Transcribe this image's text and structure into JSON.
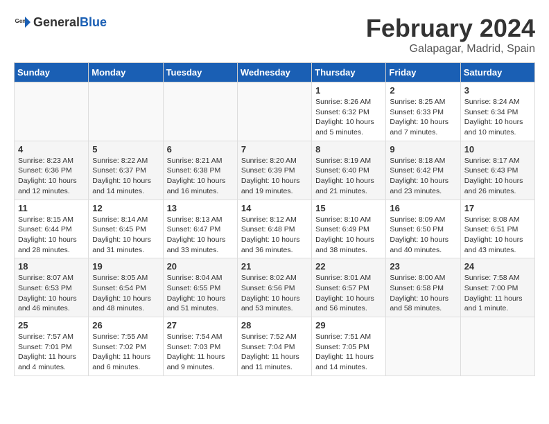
{
  "header": {
    "logo_general": "General",
    "logo_blue": "Blue",
    "main_title": "February 2024",
    "subtitle": "Galapagar, Madrid, Spain"
  },
  "calendar": {
    "columns": [
      "Sunday",
      "Monday",
      "Tuesday",
      "Wednesday",
      "Thursday",
      "Friday",
      "Saturday"
    ],
    "rows": [
      [
        {
          "day": "",
          "info": ""
        },
        {
          "day": "",
          "info": ""
        },
        {
          "day": "",
          "info": ""
        },
        {
          "day": "",
          "info": ""
        },
        {
          "day": "1",
          "info": "Sunrise: 8:26 AM\nSunset: 6:32 PM\nDaylight: 10 hours\nand 5 minutes."
        },
        {
          "day": "2",
          "info": "Sunrise: 8:25 AM\nSunset: 6:33 PM\nDaylight: 10 hours\nand 7 minutes."
        },
        {
          "day": "3",
          "info": "Sunrise: 8:24 AM\nSunset: 6:34 PM\nDaylight: 10 hours\nand 10 minutes."
        }
      ],
      [
        {
          "day": "4",
          "info": "Sunrise: 8:23 AM\nSunset: 6:36 PM\nDaylight: 10 hours\nand 12 minutes."
        },
        {
          "day": "5",
          "info": "Sunrise: 8:22 AM\nSunset: 6:37 PM\nDaylight: 10 hours\nand 14 minutes."
        },
        {
          "day": "6",
          "info": "Sunrise: 8:21 AM\nSunset: 6:38 PM\nDaylight: 10 hours\nand 16 minutes."
        },
        {
          "day": "7",
          "info": "Sunrise: 8:20 AM\nSunset: 6:39 PM\nDaylight: 10 hours\nand 19 minutes."
        },
        {
          "day": "8",
          "info": "Sunrise: 8:19 AM\nSunset: 6:40 PM\nDaylight: 10 hours\nand 21 minutes."
        },
        {
          "day": "9",
          "info": "Sunrise: 8:18 AM\nSunset: 6:42 PM\nDaylight: 10 hours\nand 23 minutes."
        },
        {
          "day": "10",
          "info": "Sunrise: 8:17 AM\nSunset: 6:43 PM\nDaylight: 10 hours\nand 26 minutes."
        }
      ],
      [
        {
          "day": "11",
          "info": "Sunrise: 8:15 AM\nSunset: 6:44 PM\nDaylight: 10 hours\nand 28 minutes."
        },
        {
          "day": "12",
          "info": "Sunrise: 8:14 AM\nSunset: 6:45 PM\nDaylight: 10 hours\nand 31 minutes."
        },
        {
          "day": "13",
          "info": "Sunrise: 8:13 AM\nSunset: 6:47 PM\nDaylight: 10 hours\nand 33 minutes."
        },
        {
          "day": "14",
          "info": "Sunrise: 8:12 AM\nSunset: 6:48 PM\nDaylight: 10 hours\nand 36 minutes."
        },
        {
          "day": "15",
          "info": "Sunrise: 8:10 AM\nSunset: 6:49 PM\nDaylight: 10 hours\nand 38 minutes."
        },
        {
          "day": "16",
          "info": "Sunrise: 8:09 AM\nSunset: 6:50 PM\nDaylight: 10 hours\nand 40 minutes."
        },
        {
          "day": "17",
          "info": "Sunrise: 8:08 AM\nSunset: 6:51 PM\nDaylight: 10 hours\nand 43 minutes."
        }
      ],
      [
        {
          "day": "18",
          "info": "Sunrise: 8:07 AM\nSunset: 6:53 PM\nDaylight: 10 hours\nand 46 minutes."
        },
        {
          "day": "19",
          "info": "Sunrise: 8:05 AM\nSunset: 6:54 PM\nDaylight: 10 hours\nand 48 minutes."
        },
        {
          "day": "20",
          "info": "Sunrise: 8:04 AM\nSunset: 6:55 PM\nDaylight: 10 hours\nand 51 minutes."
        },
        {
          "day": "21",
          "info": "Sunrise: 8:02 AM\nSunset: 6:56 PM\nDaylight: 10 hours\nand 53 minutes."
        },
        {
          "day": "22",
          "info": "Sunrise: 8:01 AM\nSunset: 6:57 PM\nDaylight: 10 hours\nand 56 minutes."
        },
        {
          "day": "23",
          "info": "Sunrise: 8:00 AM\nSunset: 6:58 PM\nDaylight: 10 hours\nand 58 minutes."
        },
        {
          "day": "24",
          "info": "Sunrise: 7:58 AM\nSunset: 7:00 PM\nDaylight: 11 hours\nand 1 minute."
        }
      ],
      [
        {
          "day": "25",
          "info": "Sunrise: 7:57 AM\nSunset: 7:01 PM\nDaylight: 11 hours\nand 4 minutes."
        },
        {
          "day": "26",
          "info": "Sunrise: 7:55 AM\nSunset: 7:02 PM\nDaylight: 11 hours\nand 6 minutes."
        },
        {
          "day": "27",
          "info": "Sunrise: 7:54 AM\nSunset: 7:03 PM\nDaylight: 11 hours\nand 9 minutes."
        },
        {
          "day": "28",
          "info": "Sunrise: 7:52 AM\nSunset: 7:04 PM\nDaylight: 11 hours\nand 11 minutes."
        },
        {
          "day": "29",
          "info": "Sunrise: 7:51 AM\nSunset: 7:05 PM\nDaylight: 11 hours\nand 14 minutes."
        },
        {
          "day": "",
          "info": ""
        },
        {
          "day": "",
          "info": ""
        }
      ]
    ]
  }
}
